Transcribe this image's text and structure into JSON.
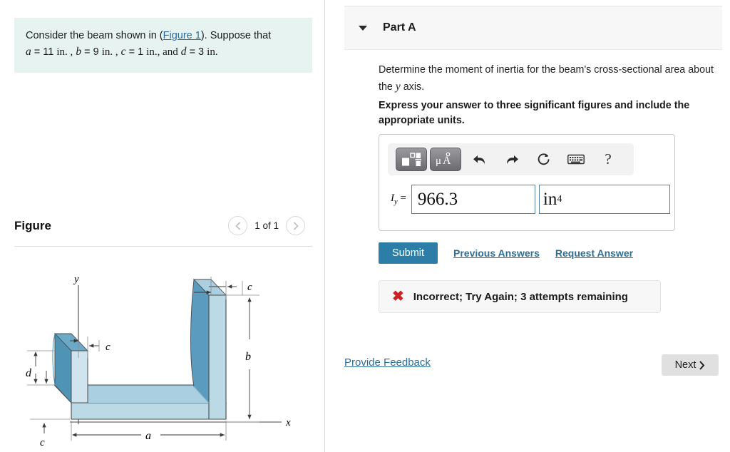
{
  "left": {
    "problem": {
      "line1_pre": "Consider the beam shown in (",
      "figure_link": "Figure 1",
      "line1_post": "). Suppose that",
      "var_a": "a",
      "val_a": "= 11",
      "unit_a": "in. ,",
      "var_b": "b",
      "val_b": "= 9",
      "unit_b": "in. ,",
      "var_c": "c",
      "val_c": "= 1",
      "unit_c": "in., and",
      "var_d": "d",
      "val_d": "= 3",
      "unit_d": "in."
    },
    "figure": {
      "title": "Figure",
      "count": "1 of 1",
      "prev_icon": "chevron-left-icon",
      "next_icon": "chevron-right-icon",
      "labels": {
        "y_axis": "y",
        "x_axis": "x",
        "a": "a",
        "b": "b",
        "c_top_right": "c",
        "c_mid_left": "c",
        "c_bottom": "c",
        "d": "d"
      }
    }
  },
  "right": {
    "part": {
      "title": "Part A",
      "caret_icon": "caret-down-icon"
    },
    "question": "Determine the moment of inertia for the beam's cross-sectional area about the y axis.",
    "question_prefix": "Determine the moment of inertia for the beam's cross-sectional area about the ",
    "question_var": "y",
    "question_suffix": " axis.",
    "instruction": "Express your answer to three significant figures and include the appropriate units.",
    "toolbar": {
      "template_icon": "math-template-icon",
      "units_icon": "micro-angstrom-units-icon",
      "undo_icon": "undo-arrow-icon",
      "redo_icon": "redo-arrow-icon",
      "reset_icon": "reset-circular-arrow-icon",
      "keyboard_icon": "keyboard-icon",
      "help_icon": "question-mark-icon",
      "help_label": "?"
    },
    "answer": {
      "label_base": "I",
      "label_sub": "y",
      "equals": "=",
      "value": "966.3",
      "unit_base": "in",
      "unit_exp": "4"
    },
    "actions": {
      "submit": "Submit",
      "previous_answers": "Previous Answers",
      "request_answer": "Request Answer"
    },
    "feedback": {
      "icon": "red-x-icon",
      "symbol": "✖",
      "message": "Incorrect; Try Again; 3 attempts remaining"
    },
    "footer": {
      "provide_feedback": "Provide Feedback",
      "next": "Next",
      "next_icon": "chevron-right-icon"
    }
  },
  "colors": {
    "accent_blue": "#2c7ea8",
    "link_blue": "#2d6e96",
    "problem_bg": "#e7f3f1",
    "error_red": "#cc2027",
    "beam_front": "#5b9bbd",
    "beam_top": "#a9cfe1",
    "beam_side": "#bcd9e6"
  }
}
